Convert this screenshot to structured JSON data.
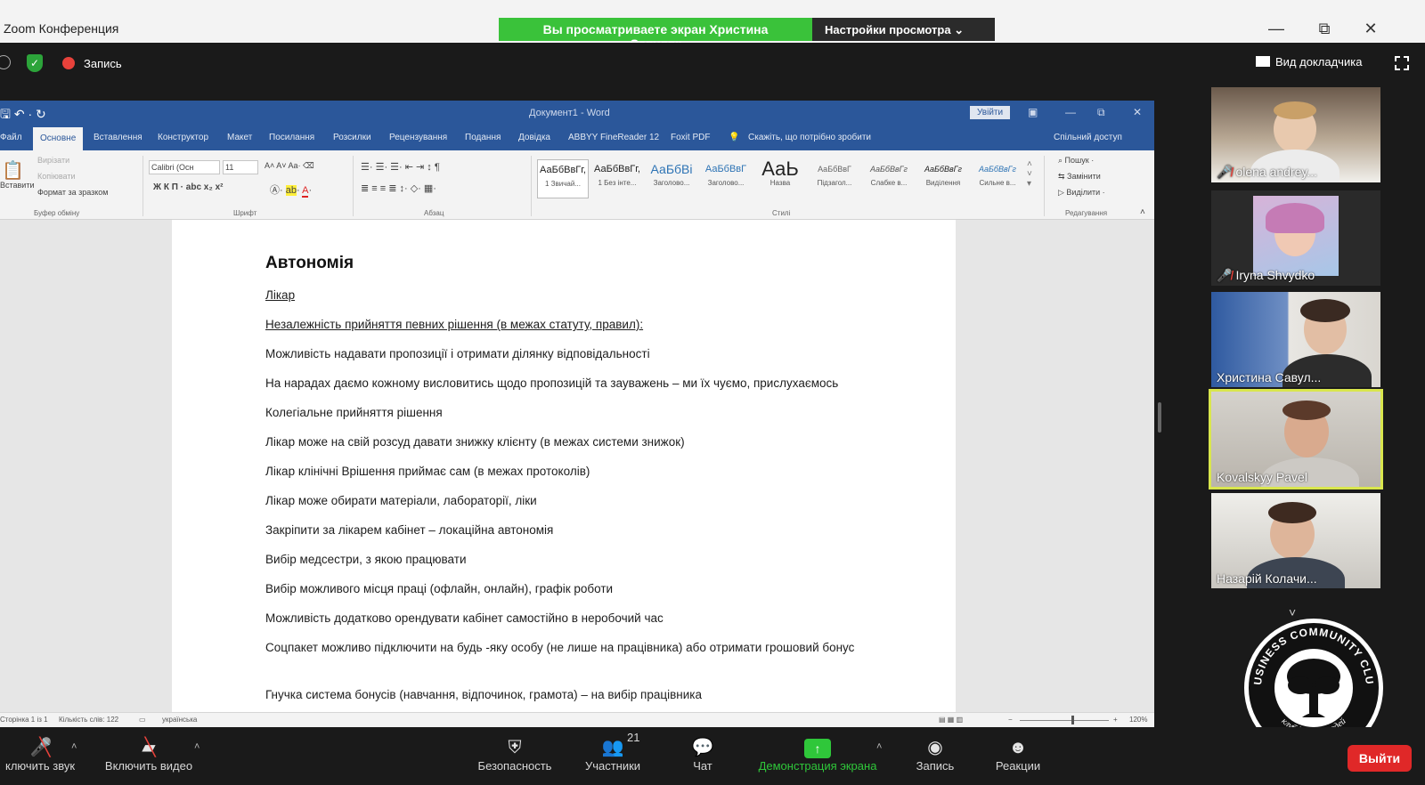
{
  "window": {
    "title": "Zoom Конференция",
    "share_banner": "Вы просматриваете экран Христина Савуляк",
    "view_settings": "Настройки просмотра ⌄",
    "minimize": "—",
    "restore": "⧉",
    "close": "✕"
  },
  "top_strip": {
    "recording": "Запись",
    "speaker_view": "Вид докладчика"
  },
  "word": {
    "doc_title": "Документ1 - Word",
    "sign_in": "Увійти",
    "tabs": [
      "Файл",
      "Основне",
      "Вставлення",
      "Конструктор",
      "Макет",
      "Посилання",
      "Розсилки",
      "Рецензування",
      "Подання",
      "Довідка",
      "ABBYY FineReader 12",
      "Foxit PDF"
    ],
    "tell_me": "Скажіть, що потрібно зробити",
    "share": "Спільний доступ",
    "clipboard": {
      "paste": "Вставити",
      "cut": "Вирізати",
      "copy": "Копіювати",
      "format_painter": "Формат за зразком",
      "group": "Буфер обміну"
    },
    "font": {
      "name": "Calibri (Осн",
      "size": "11",
      "group": "Шрифт"
    },
    "paragraph_group": "Абзац",
    "styles": [
      {
        "sample": "АаБбВвГг,",
        "name": "1 Звичай..."
      },
      {
        "sample": "АаБбВвГг,",
        "name": "1 Без інте..."
      },
      {
        "sample": "АаБбВі",
        "name": "Заголово..."
      },
      {
        "sample": "АаБбВвГ",
        "name": "Заголово..."
      },
      {
        "sample": "АаЬ",
        "name": "Назва"
      },
      {
        "sample": "АаБбВвГ",
        "name": "Підзагол..."
      },
      {
        "sample": "АаБбВвГг",
        "name": "Слабке в..."
      },
      {
        "sample": "АаБбВвГг",
        "name": "Виділення"
      },
      {
        "sample": "АаБбВвГг",
        "name": "Сильне в..."
      }
    ],
    "styles_group": "Стилі",
    "editing": {
      "find": "Пошук",
      "replace": "Замінити",
      "select": "Виділити",
      "group": "Редагування"
    },
    "document": {
      "heading": "Автономія",
      "lines": [
        "Лікар",
        "Незалежність прийняття певних рішення (в межах статуту, правил):",
        "Можливість надавати пропозиції і отримати ділянку відповідальності",
        "На нарадах даємо кожному висловитись щодо пропозицій та зауважень – ми їх чуємо, прислухаємось",
        "Колегіальне прийняття рішення",
        "Лікар може на свій розсуд давати знижку клієнту (в межах системи знижок)",
        "Лікар клінічні Врішення приймає сам (в межах протоколів)",
        "Лікар може обирати матеріали, лабораторії, ліки",
        "Закріпити за лікарем кабінет – локаційна автономія",
        "Вибір медсестри, з якою працювати",
        "Вибір можливого місця праці (офлайн, онлайн), графік роботи",
        "Можливість додатково орендувати кабінет самостійно в неробочий час",
        "Соцпакет можливо підключити на будь -яку особу (не лише на працівника) або отримати грошовий бонус",
        "Гнучка система бонусів (навчання, відпочинок, грамота) – на вибір працівника"
      ]
    },
    "status": {
      "page": "Сторінка 1 із 1",
      "words": "Кількість слів: 122",
      "language": "українська",
      "zoom": "120%"
    }
  },
  "participants": [
    {
      "name": "olena andrey...",
      "muted": true
    },
    {
      "name": "Iryna Shvydko",
      "muted": true
    },
    {
      "name": "Христина Савул...",
      "muted": false
    },
    {
      "name": "Kovalskyy Pavel",
      "muted": false,
      "active": true
    },
    {
      "name": "Назарій Колачи...",
      "muted": false
    }
  ],
  "toolbar": {
    "mute": "ключить звук",
    "video": "Включить видео",
    "security": "Безопасность",
    "participants": "Участники",
    "participants_count": "21",
    "chat": "Чат",
    "share": "Демонстрация экрана",
    "record": "Запись",
    "reactions": "Реакции",
    "leave": "Выйти"
  },
  "logo": {
    "top": "BUSINESS COMMUNITY CLUB",
    "bottom": "клуб ділових людей"
  },
  "colors": {
    "zoom_green": "#3ac23a",
    "word_blue": "#2b579a",
    "leave_red": "#e02828",
    "active_speaker": "#d9e64d"
  }
}
